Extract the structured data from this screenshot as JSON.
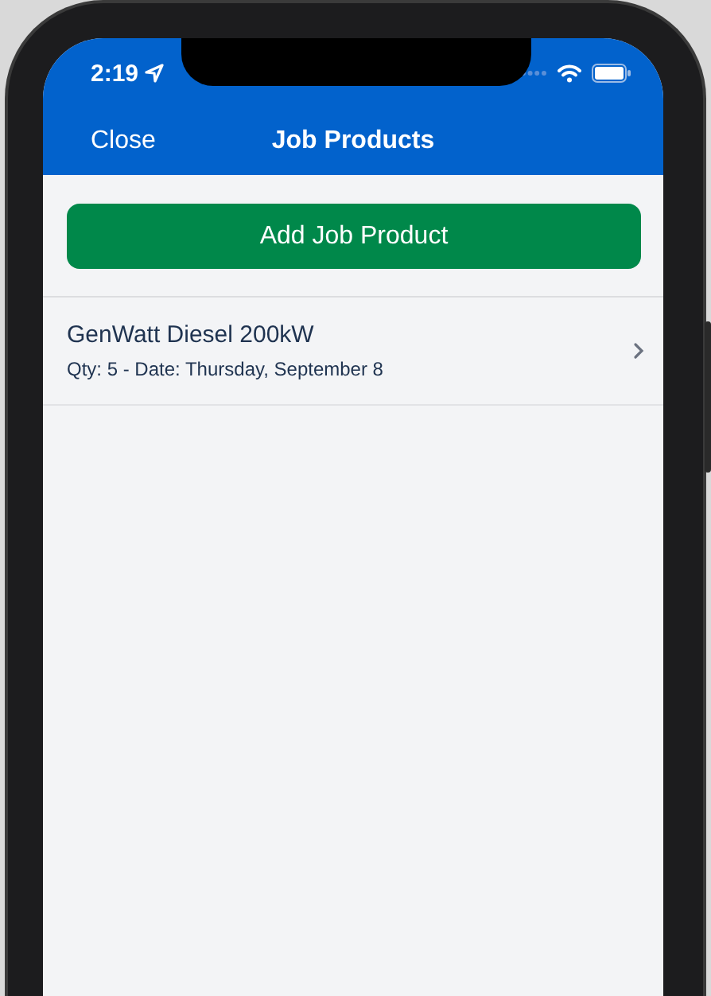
{
  "status_bar": {
    "time": "2:19"
  },
  "nav_bar": {
    "close_button": "Close",
    "title": "Job Products"
  },
  "add_button": {
    "label": "Add Job Product"
  },
  "products": [
    {
      "name": "GenWatt Diesel 200kW",
      "details": "Qty: 5 - Date: Thursday, September 8"
    }
  ]
}
